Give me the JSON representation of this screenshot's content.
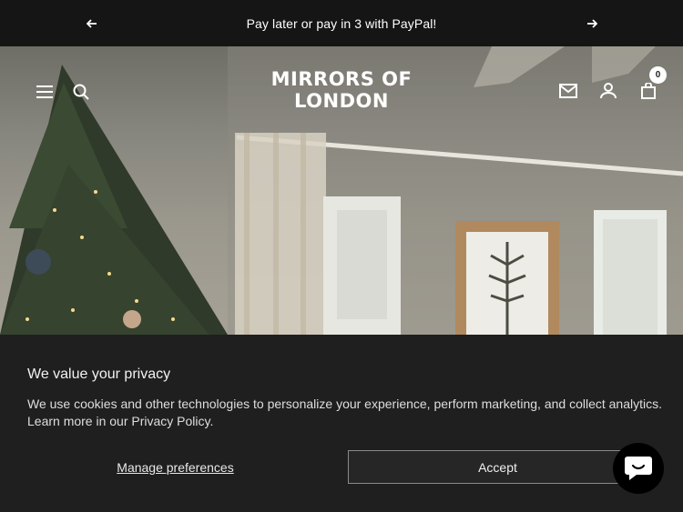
{
  "announcement": {
    "text": "Pay later or pay in 3 with PayPal!",
    "prev_icon": "arrow-left-icon",
    "next_icon": "arrow-right-icon"
  },
  "header": {
    "logo_line1": "MIRRORS OF",
    "logo_line2": "LONDON",
    "left_icons": [
      "menu-icon",
      "search-icon"
    ],
    "right_icons": [
      "mail-icon",
      "account-icon",
      "cart-icon"
    ],
    "cart_count": "0"
  },
  "privacy_banner": {
    "title": "We value your privacy",
    "body": "We use cookies and other technologies to personalize your experience, perform marketing, and collect analytics. Learn more in our Privacy Policy.",
    "manage_label": "Manage preferences",
    "accept_label": "Accept"
  },
  "chat": {
    "icon": "chat-bubble-icon"
  },
  "colors": {
    "background": "#1f1f1f",
    "announcement_bar": "#151515",
    "text": "#ffffff"
  }
}
